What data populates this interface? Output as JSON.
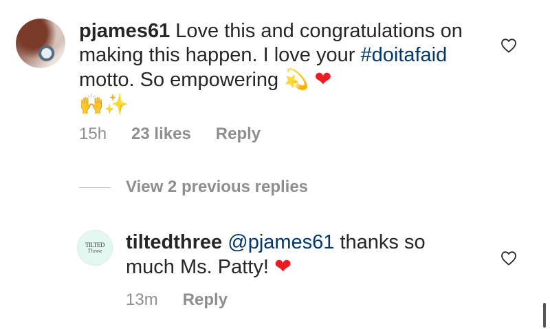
{
  "comments": [
    {
      "username": "pjames61",
      "text_before_hashtag": " Love this and congratulations on making this happen. I love your ",
      "hashtag": "#doitafaid",
      "text_after_hashtag": " motto. So empowering ",
      "emojis": [
        "💫",
        "❤",
        "🙌",
        "✨"
      ],
      "time": "15h",
      "likes": "23 likes",
      "reply_label": "Reply"
    },
    {
      "username": "tiltedthree",
      "mention": "@pjames61",
      "text": " thanks so much Ms. Patty! ",
      "emoji": "❤",
      "avatar_logo_top": "TILTED",
      "avatar_logo_bottom": "Three",
      "time": "13m",
      "reply_label": "Reply"
    }
  ],
  "view_replies": {
    "label": "View 2 previous replies"
  },
  "icons": {
    "like": "heart-outline-icon"
  },
  "colors": {
    "text": "#262626",
    "secondary": "#8e8e8e",
    "link": "#00376b",
    "heart": "#ed1c24"
  }
}
